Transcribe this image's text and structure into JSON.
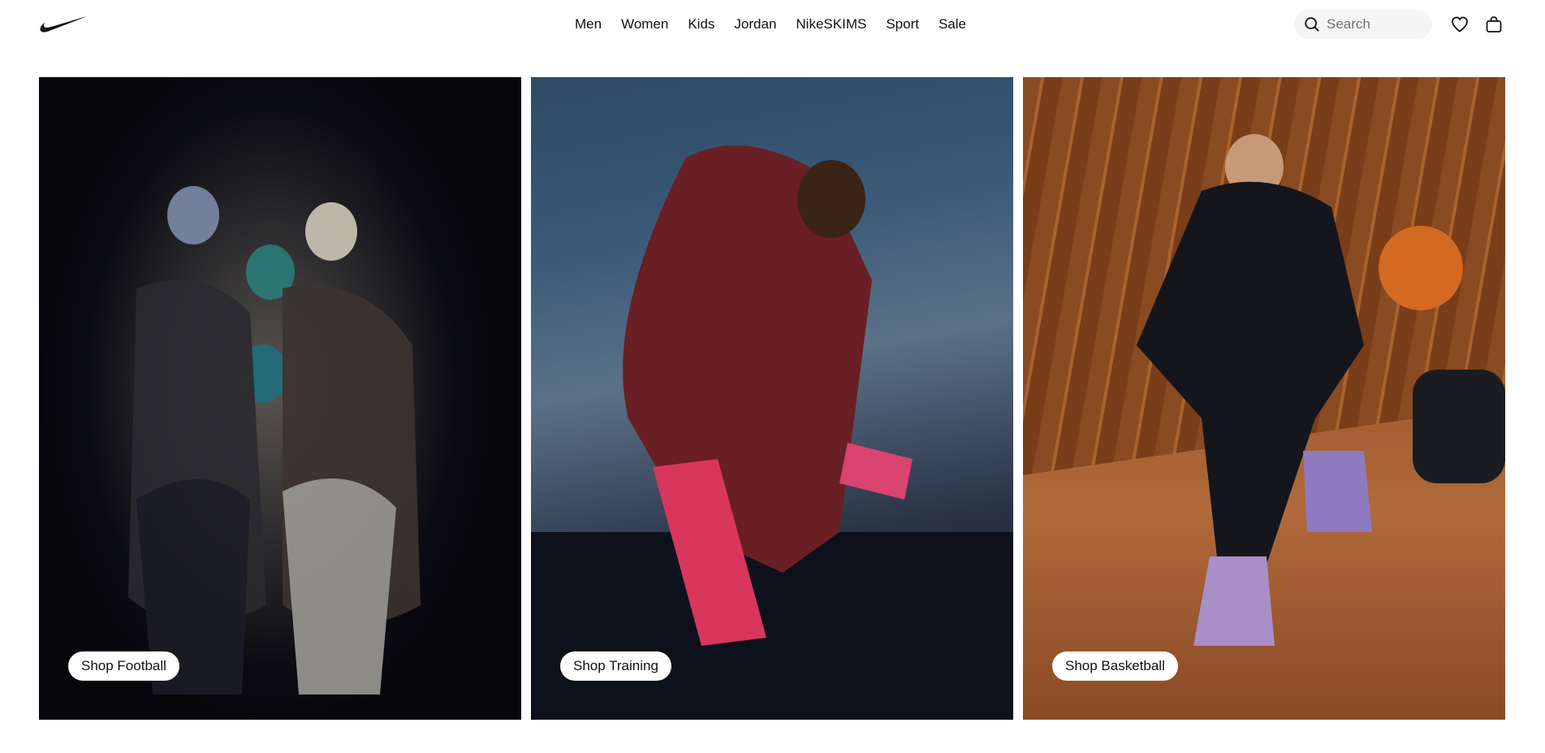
{
  "header": {
    "logo": "swoosh-logo",
    "nav": [
      "Men",
      "Women",
      "Kids",
      "Jordan",
      "NikeSKIMS",
      "Sport",
      "Sale"
    ],
    "search_placeholder": "Search",
    "icons": {
      "search": "search-icon",
      "favorites": "heart-icon",
      "bag": "bag-icon"
    }
  },
  "cards": [
    {
      "button_label": "Shop Football",
      "image": "football-players-photo"
    },
    {
      "button_label": "Shop Training",
      "image": "training-athlete-photo"
    },
    {
      "button_label": "Shop Basketball",
      "image": "basketball-player-photo"
    }
  ],
  "colors": {
    "text": "#111111",
    "search_bg": "#f5f5f5",
    "button_bg": "#ffffff"
  }
}
